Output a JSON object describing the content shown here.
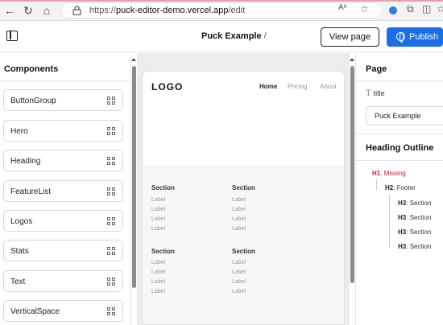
{
  "browser": {
    "url_prefix": "https://",
    "url_host": "puck-editor-demo.vercel.app",
    "url_path": "/edit",
    "nav_icons": [
      "back-arrow-icon",
      "reload-icon",
      "home-icon"
    ],
    "toolbar_icons": [
      "read-aloud-icon",
      "favorite-star-icon",
      "copilot-icon",
      "extensions-icon",
      "split-screen-icon",
      "favorites-icon"
    ]
  },
  "header": {
    "title": "Puck Example",
    "title_suffix": "/",
    "view_page_label": "View page",
    "publish_label": "Publish",
    "accent_color": "#1a6ee6"
  },
  "components": {
    "title": "Components",
    "items": [
      {
        "label": "ButtonGroup"
      },
      {
        "label": "Hero"
      },
      {
        "label": "Heading"
      },
      {
        "label": "FeatureList"
      },
      {
        "label": "Logos"
      },
      {
        "label": "Stats"
      },
      {
        "label": "Text"
      },
      {
        "label": "VerticalSpace"
      }
    ]
  },
  "canvas": {
    "logo": "LOGO",
    "nav": {
      "home": "Home",
      "pricing": "Pricing",
      "about": "About"
    },
    "sections": [
      {
        "title": "Section",
        "labels": [
          "Label",
          "Label",
          "Label",
          "Label"
        ]
      },
      {
        "title": "Section",
        "labels": [
          "Label",
          "Label",
          "Label",
          "Label"
        ]
      },
      {
        "title": "Section",
        "labels": [
          "Label",
          "Label",
          "Label",
          "Label"
        ]
      },
      {
        "title": "Section",
        "labels": [
          "Label",
          "Label",
          "Label",
          "Label"
        ]
      }
    ]
  },
  "page_panel": {
    "title": "Page",
    "field_label": "title",
    "field_icon": "T",
    "title_value": "Puck Example",
    "outline_title": "Heading Outline",
    "outline": [
      {
        "level": "H1",
        "text": "Missing",
        "missing": true
      },
      {
        "level": "H2",
        "text": "Footer"
      },
      {
        "level": "H3",
        "text": "Section"
      },
      {
        "level": "H3",
        "text": "Section"
      },
      {
        "level": "H3",
        "text": "Section"
      },
      {
        "level": "H3",
        "text": "Section"
      }
    ],
    "missing_color": "#c0202f"
  }
}
